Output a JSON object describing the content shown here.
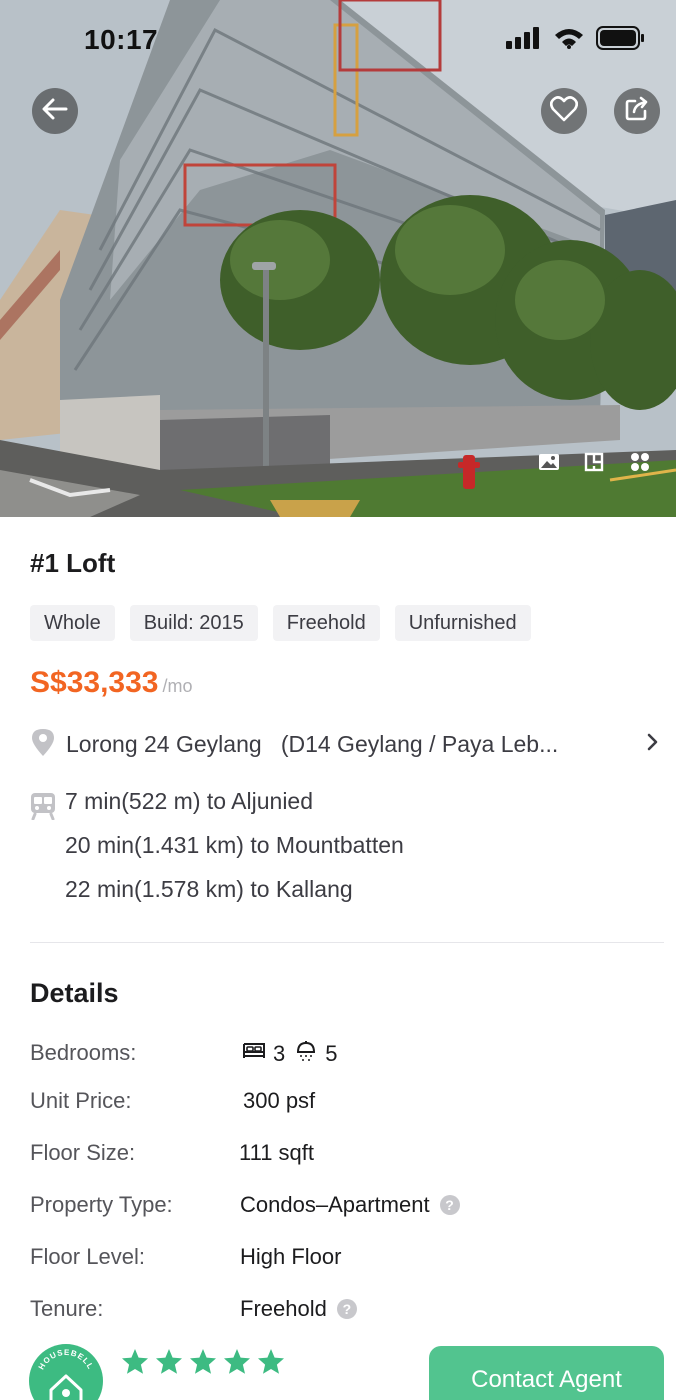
{
  "status_bar": {
    "time": "10:17"
  },
  "hero": {
    "icons": [
      "back-arrow-icon",
      "heart-icon",
      "share-icon",
      "image-icon",
      "floorplan-icon",
      "grid-icon"
    ]
  },
  "listing": {
    "title": "#1 Loft",
    "tags": [
      "Whole",
      "Build: 2015",
      "Freehold",
      "Unfurnished"
    ],
    "price": "S$33,333",
    "price_unit": "/mo",
    "address": "Lorong 24 Geylang   (D14 Geylang / Paya Leb...",
    "transit": [
      "7 min(522 m) to Aljunied",
      "20 min(1.431 km) to Mountbatten",
      "22 min(1.578 km) to Kallang"
    ]
  },
  "details": {
    "heading": "Details",
    "bedrooms_label": "Bedrooms:",
    "bedrooms_value": "3",
    "bathrooms_value": "5",
    "unit_price_label": "Unit Price:",
    "unit_price_value": "300 psf",
    "floor_size_label": "Floor Size:",
    "floor_size_value": "111 sqft",
    "property_type_label": "Property Type:",
    "property_type_value": "Condos–Apartment",
    "floor_level_label": "Floor Level:",
    "floor_level_value": "High Floor",
    "tenure_label": "Tenure:",
    "tenure_value": "Freehold"
  },
  "agent": {
    "logo_text": "HOUSEBELL",
    "rating": 5,
    "contact_label": "Contact Agent"
  },
  "colors": {
    "price": "#f26522",
    "accent_green": "#52c48f",
    "star_green": "#3dbb82"
  }
}
